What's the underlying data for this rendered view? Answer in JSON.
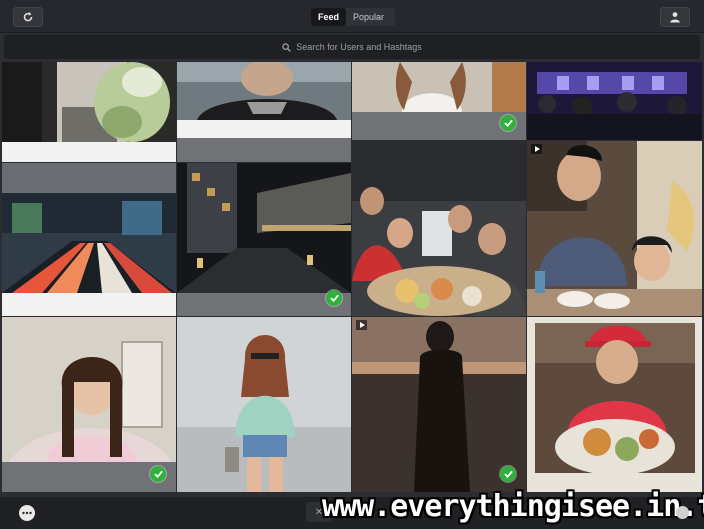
{
  "header": {
    "tabs": [
      {
        "label": "Feed",
        "active": true
      },
      {
        "label": "Popular",
        "active": false
      }
    ]
  },
  "search": {
    "placeholder": "Search for Users and Hashtags"
  },
  "tiles": [
    {
      "row": 1,
      "col": 1,
      "subject": "couple with flower bouquet",
      "liked": false,
      "video": false
    },
    {
      "row": 1,
      "col": 2,
      "subject": "selfie in black t-shirt",
      "liked": false,
      "video": false
    },
    {
      "row": 1,
      "col": 3,
      "subject": "person in white shirt",
      "liked": true,
      "video": false
    },
    {
      "row": 1,
      "col": 4,
      "subject": "audience at event",
      "liked": false,
      "video": false
    },
    {
      "row": 2,
      "col": 1,
      "subject": "city traffic light trails",
      "liked": false,
      "video": false
    },
    {
      "row": 2,
      "col": 2,
      "subject": "city street at night",
      "liked": true,
      "video": false
    },
    {
      "row": 2,
      "col": 3,
      "subject": "friends at dinner table",
      "liked": false,
      "video": false
    },
    {
      "row": 2,
      "col": 4,
      "subject": "man and child at table",
      "liked": false,
      "video": true
    },
    {
      "row": 3,
      "col": 1,
      "subject": "woman selfie pink top",
      "liked": true,
      "video": false
    },
    {
      "row": 3,
      "col": 2,
      "subject": "woman with sunglasses",
      "liked": false,
      "video": false
    },
    {
      "row": 3,
      "col": 3,
      "subject": "silhouette at sunset beach",
      "liked": true,
      "video": true
    },
    {
      "row": 3,
      "col": 4,
      "subject": "man with red cap and food",
      "liked": false,
      "video": false
    }
  ],
  "watermark": "www.everythingisee.in.th",
  "colors": {
    "bar": "#26282d",
    "like_green": "#2fb13b",
    "tab_active": "#17181b"
  },
  "icons": {
    "refresh": "refresh-icon",
    "profile": "profile-icon",
    "search": "search-icon",
    "chat": "chat-bubble-icon",
    "check": "check-icon",
    "play": "video-play-icon"
  }
}
